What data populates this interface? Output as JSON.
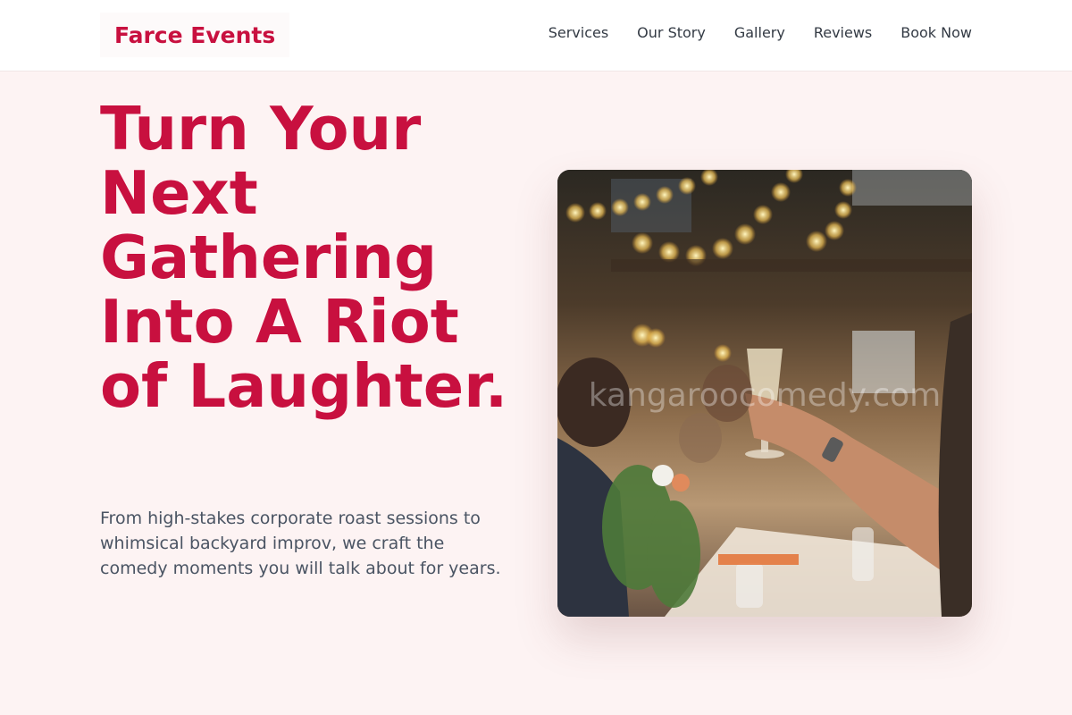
{
  "header": {
    "brand": "Farce Events",
    "nav": [
      {
        "label": "Services"
      },
      {
        "label": "Our Story"
      },
      {
        "label": "Gallery"
      },
      {
        "label": "Reviews"
      },
      {
        "label": "Book Now"
      }
    ]
  },
  "hero": {
    "title": "Turn Your Next Gathering Into A Riot of Laughter.",
    "subtitle": "From high-stakes corporate roast sessions to whimsical backyard improv, we craft the comedy moments you will talk about for years.",
    "image_watermark": "kangaroocomedy.com"
  },
  "colors": {
    "accent": "#c8103f",
    "background": "#fdf3f3",
    "header_bg": "#ffffff",
    "body_text": "#4a5463",
    "nav_text": "#333a44"
  }
}
